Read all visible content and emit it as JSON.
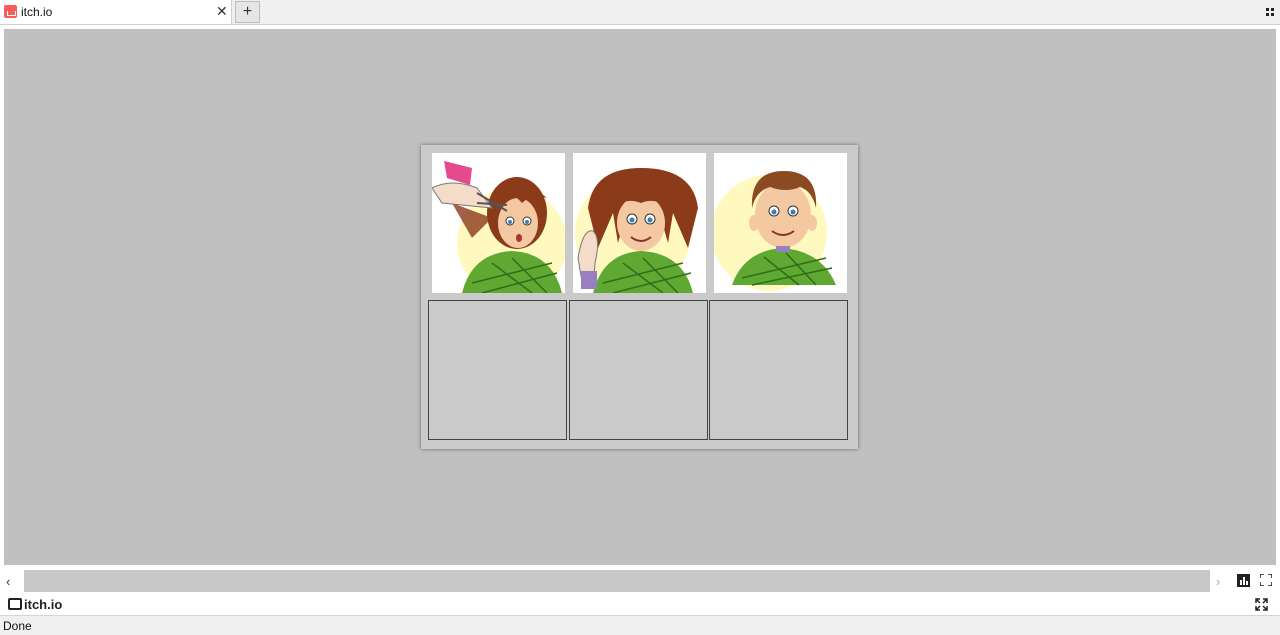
{
  "tab": {
    "title": "itch.io",
    "close": "✕",
    "new_tab": "+"
  },
  "game": {
    "pictures": [
      {
        "icon": "girl-haircut-scissors-image",
        "hair_color": "#8b3a1a",
        "shirt_color": "#5fa832"
      },
      {
        "icon": "boy-long-messy-hair-image",
        "hair_color": "#8b3a1a",
        "shirt_color": "#5fa832"
      },
      {
        "icon": "boy-short-haircut-image",
        "hair_color": "#8b4a22",
        "shirt_color": "#5fa832"
      }
    ],
    "drop_slots": 3
  },
  "scrollbar": {
    "left_arrow": "‹",
    "right_arrow": "›"
  },
  "itch_bar": {
    "brand": "itch.io"
  },
  "status": {
    "text": "Done"
  },
  "colors": {
    "itch_red": "#fa5c5c",
    "canvas_bg": "#c0c0c0"
  }
}
